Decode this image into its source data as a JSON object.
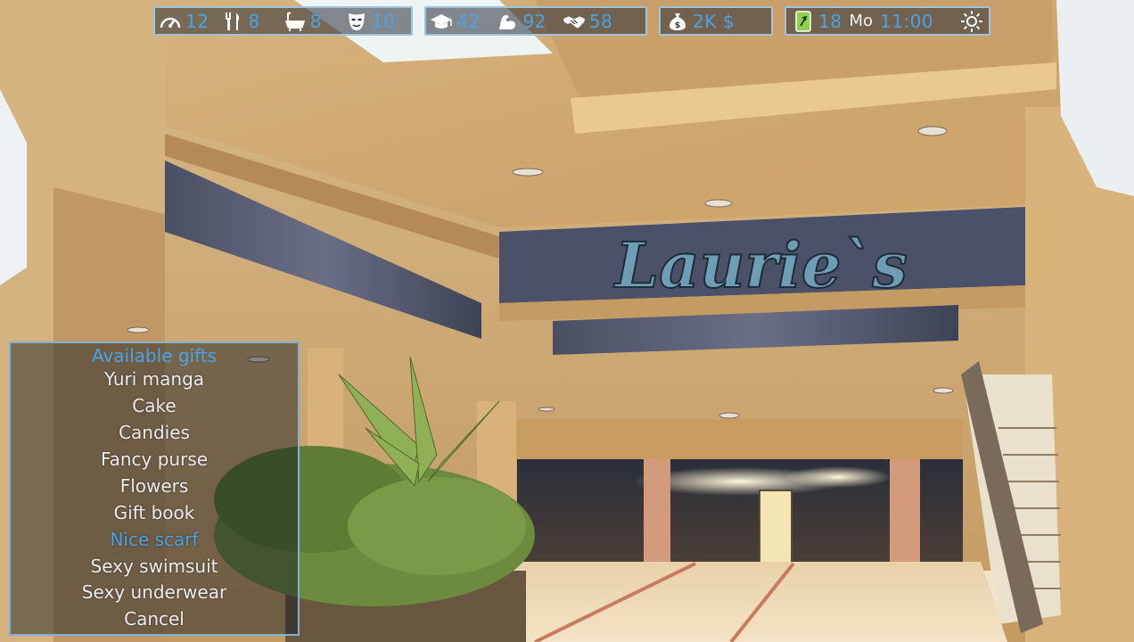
{
  "hud": {
    "group1": [
      {
        "icon": "speedometer-icon",
        "value": "12"
      },
      {
        "icon": "fork-knife-icon",
        "value": "8"
      },
      {
        "icon": "bathtub-icon",
        "value": "8"
      },
      {
        "icon": "mask-icon",
        "value": "10"
      }
    ],
    "group2": [
      {
        "icon": "graduation-cap-icon",
        "value": "42"
      },
      {
        "icon": "muscle-arm-icon",
        "value": "92"
      },
      {
        "icon": "handshake-icon",
        "value": "58"
      }
    ],
    "money": {
      "icon": "money-bag-icon",
      "value": "2K $"
    },
    "time": {
      "icon": "phone-icon",
      "day": "18",
      "weekday": "Mo",
      "clock": "11:00",
      "weather_icon": "sun-icon"
    }
  },
  "scene": {
    "store_sign": "Laurie`s"
  },
  "gift_menu": {
    "title": "Available gifts",
    "items": [
      "Yuri manga",
      "Cake",
      "Candies",
      "Fancy purse",
      "Flowers",
      "Gift book",
      "Nice scarf",
      "Sexy swimsuit",
      "Sexy underwear",
      "Cancel"
    ],
    "selected": "Nice scarf"
  },
  "colors": {
    "hud_value": "#4aa3e6",
    "hud_border": "#9ec3dc",
    "menu_text": "#ececec",
    "menu_highlight": "#4aa3e6"
  }
}
